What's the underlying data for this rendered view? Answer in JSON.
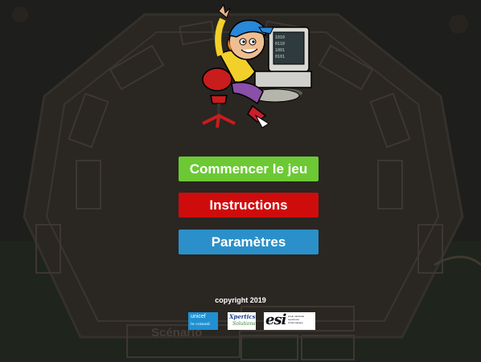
{
  "menu": {
    "start_label": "Commencer le jeu",
    "instructions_label": "Instructions",
    "settings_label": "Paramètres"
  },
  "footer": {
    "copyright": "copyright 2019",
    "logos": {
      "unicef_line1": "unicef",
      "unicef_line2": "le conseil",
      "xpertics_line1": "Xpertics",
      "xpertics_line2": "Solutions",
      "esi_mark": "esi",
      "esi_caption": "école nationale supérieure d'informatique"
    }
  },
  "background": {
    "ghost_label": "Scénario"
  },
  "colors": {
    "background": "#1e1e1c",
    "start_button": "#6cc934",
    "instructions_button": "#cf0c0c",
    "settings_button": "#2b90c9"
  },
  "icons": {
    "mascot": "cartoon-kid-at-computer",
    "logo_unicef": "unicef-logo",
    "logo_xpertics": "xpertics-logo",
    "logo_esi": "esi-logo"
  }
}
